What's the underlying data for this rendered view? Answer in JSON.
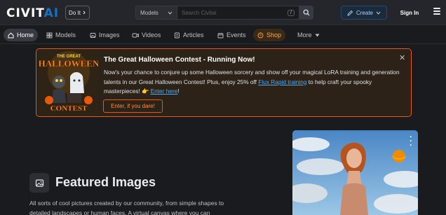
{
  "header": {
    "logo_main": "CIVIT",
    "logo_ai": "AI",
    "doit_label": "Do It",
    "search_category": "Models",
    "search_placeholder": "Search Civitai",
    "search_shortcut": "/",
    "create_label": "Create",
    "signin_label": "Sign In"
  },
  "nav": {
    "items": [
      {
        "label": "Home",
        "icon": "home-icon"
      },
      {
        "label": "Models",
        "icon": "grid-icon"
      },
      {
        "label": "Images",
        "icon": "image-icon"
      },
      {
        "label": "Videos",
        "icon": "video-icon"
      },
      {
        "label": "Articles",
        "icon": "article-icon"
      },
      {
        "label": "Events",
        "icon": "calendar-icon"
      },
      {
        "label": "Shop",
        "icon": "shop-icon"
      },
      {
        "label": "More",
        "icon": "caret-down-icon"
      }
    ]
  },
  "banner": {
    "image_text_1": "THE GREAT",
    "image_text_2": "HALLOWEEN",
    "image_text_3": "CONTEST",
    "title": "The Great Halloween Contest - Running Now!",
    "text_before_link1": "Now's your chance to conjure up some Halloween sorcery and show off your magical LoRA training and generation talents in our Great Halloween Contest! Plus, enjoy 25% off ",
    "link1": "Flux Rapid training",
    "text_after_link1": " to help craft your spooky masterpieces! ",
    "link2": "Enter here",
    "text_end": "!",
    "button_label": "Enter, if you dare!",
    "accent_color": "#e8590c"
  },
  "featured": {
    "title": "Featured Images",
    "description": "All sorts of cool pictures created by our community, from simple shapes to detailed landscapes or human faces. A virtual canvas where you can"
  },
  "colors": {
    "background": "#1a1b1e",
    "header": "#25262b",
    "link": "#4dabf7"
  }
}
